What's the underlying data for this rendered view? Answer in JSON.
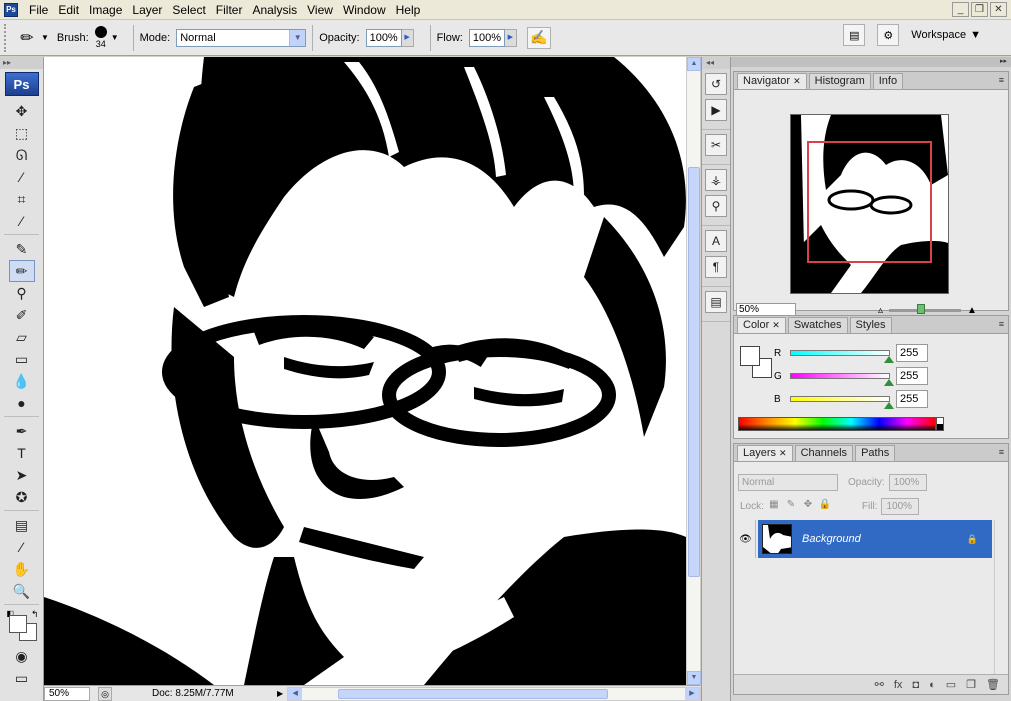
{
  "app": {
    "icon_label": "Ps",
    "menu": [
      "File",
      "Edit",
      "Image",
      "Layer",
      "Select",
      "Filter",
      "Analysis",
      "View",
      "Window",
      "Help"
    ],
    "window_controls": [
      "_",
      "❐",
      "✕"
    ]
  },
  "options_bar": {
    "brush_label": "Brush:",
    "brush_size": "34",
    "mode_label": "Mode:",
    "mode_value": "Normal",
    "opacity_label": "Opacity:",
    "opacity_value": "100%",
    "flow_label": "Flow:",
    "flow_value": "100%",
    "workspace_label": "Workspace"
  },
  "toolbox": {
    "ps_label": "Ps",
    "tools": [
      {
        "name": "move-tool-icon",
        "glyph": "✥"
      },
      {
        "name": "marquee-tool-icon",
        "glyph": "⬚"
      },
      {
        "name": "lasso-tool-icon",
        "glyph": "ᘏ"
      },
      {
        "name": "magic-wand-tool-icon",
        "glyph": "⁄"
      },
      {
        "name": "crop-tool-icon",
        "glyph": "⌗"
      },
      {
        "name": "eyedropper-tool-icon",
        "glyph": "⁄"
      },
      {
        "name": "healing-brush-tool-icon",
        "glyph": "✎"
      },
      {
        "name": "brush-tool-icon",
        "glyph": "✏"
      },
      {
        "name": "clone-stamp-tool-icon",
        "glyph": "⚲"
      },
      {
        "name": "history-brush-tool-icon",
        "glyph": "✐"
      },
      {
        "name": "eraser-tool-icon",
        "glyph": "▱"
      },
      {
        "name": "gradient-tool-icon",
        "glyph": "▭"
      },
      {
        "name": "blur-tool-icon",
        "glyph": "💧"
      },
      {
        "name": "dodge-tool-icon",
        "glyph": "●"
      },
      {
        "name": "pen-tool-icon",
        "glyph": "✒"
      },
      {
        "name": "type-tool-icon",
        "glyph": "T"
      },
      {
        "name": "path-selection-tool-icon",
        "glyph": "➤"
      },
      {
        "name": "shape-tool-icon",
        "glyph": "✪"
      },
      {
        "name": "notes-tool-icon",
        "glyph": "▤"
      },
      {
        "name": "color-sampler-tool-icon",
        "glyph": "⁄"
      },
      {
        "name": "hand-tool-icon",
        "glyph": "✋"
      },
      {
        "name": "zoom-tool-icon",
        "glyph": "🔍"
      }
    ]
  },
  "status": {
    "zoom": "50%",
    "doc_size": "Doc: 8.25M/7.77M"
  },
  "navigator": {
    "tabs": [
      {
        "label": "Navigator",
        "active": true,
        "closable": true
      },
      {
        "label": "Histogram"
      },
      {
        "label": "Info"
      }
    ],
    "zoom_value": "50%"
  },
  "color_panel": {
    "tabs": [
      {
        "label": "Color",
        "active": true,
        "closable": true
      },
      {
        "label": "Swatches"
      },
      {
        "label": "Styles"
      }
    ],
    "channels": [
      {
        "label": "R",
        "value": "255",
        "gradient": "linear-gradient(to right,#00ffff,#ffffff)"
      },
      {
        "label": "G",
        "value": "255",
        "gradient": "linear-gradient(to right,#ff00ff,#ffffff)"
      },
      {
        "label": "B",
        "value": "255",
        "gradient": "linear-gradient(to right,#ffff00,#ffffff)"
      }
    ]
  },
  "layers_panel": {
    "tabs": [
      {
        "label": "Layers",
        "active": true,
        "closable": true
      },
      {
        "label": "Channels"
      },
      {
        "label": "Paths"
      }
    ],
    "blend_mode": "Normal",
    "opacity_label": "Opacity:",
    "opacity_value": "100%",
    "lock_label": "Lock:",
    "fill_label": "Fill:",
    "fill_value": "100%",
    "layer_name": "Background",
    "selection_color": "#316ac5"
  }
}
